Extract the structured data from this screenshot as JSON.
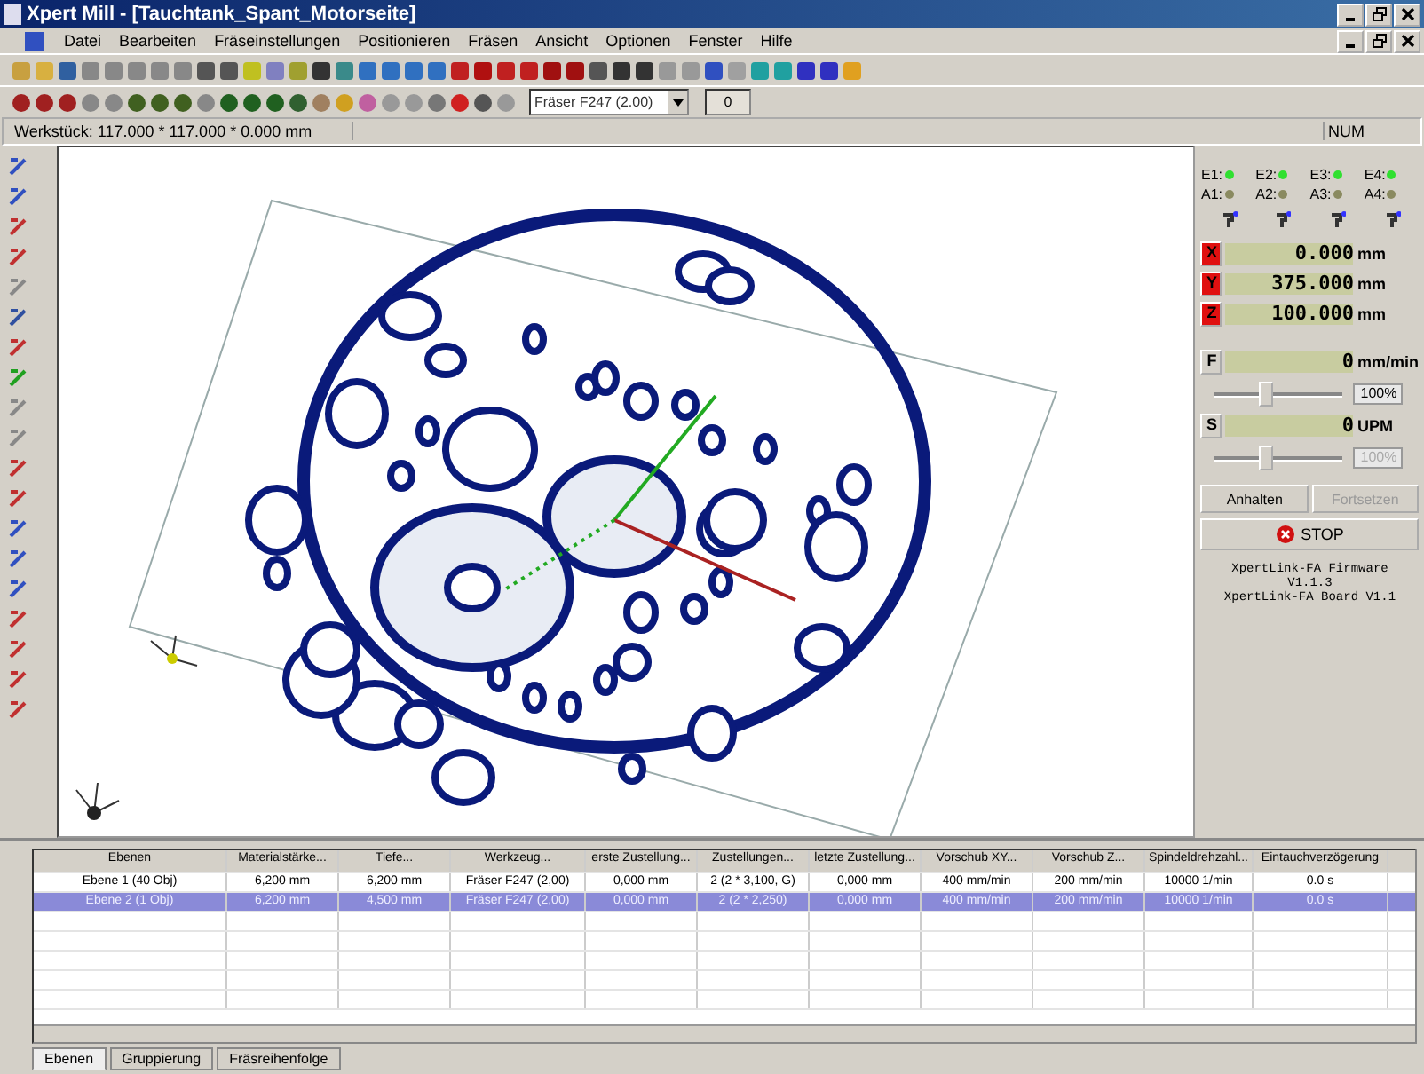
{
  "window": {
    "title": "Xpert Mill - [Tauchtank_Spant_Motorseite]"
  },
  "menu": [
    "Datei",
    "Bearbeiten",
    "Fräseinstellungen",
    "Positionieren",
    "Fräsen",
    "Ansicht",
    "Optionen",
    "Fenster",
    "Hilfe"
  ],
  "toolbar": {
    "tool_select": "Fräser F247 (2.00)",
    "spin_value": "0"
  },
  "info_bar": {
    "workpiece": "Werkstück: 117.000 * 117.000 * 0.000 mm",
    "indicator": "NUM"
  },
  "control_panel": {
    "leds": [
      {
        "label": "E1:",
        "on": true
      },
      {
        "label": "E2:",
        "on": true
      },
      {
        "label": "E3:",
        "on": true
      },
      {
        "label": "E4:",
        "on": true
      },
      {
        "label": "A1:",
        "on": false
      },
      {
        "label": "A2:",
        "on": false
      },
      {
        "label": "A3:",
        "on": false
      },
      {
        "label": "A4:",
        "on": false
      }
    ],
    "axes": [
      {
        "label": "X",
        "value": "0.000",
        "unit": "mm"
      },
      {
        "label": "Y",
        "value": "375.000",
        "unit": "mm"
      },
      {
        "label": "Z",
        "value": "100.000",
        "unit": "mm"
      }
    ],
    "feed": {
      "label": "F",
      "value": "0",
      "unit": "mm/min",
      "level": 0.38,
      "override": "100%",
      "disabled": false
    },
    "spindle": {
      "label": "S",
      "value": "0",
      "unit": "UPM",
      "level": 0.38,
      "override": "100%",
      "disabled": true
    },
    "buttons": [
      {
        "label": "Anhalten",
        "disabled": false
      },
      {
        "label": "Fortsetzen",
        "disabled": true
      }
    ],
    "stop": "STOP",
    "firmware": [
      "XpertLink-FA Firmware",
      "V1.1.3",
      "XpertLink-FA Board V1.1"
    ]
  },
  "table": {
    "columns": [
      "Ebenen",
      "Materialstärke...",
      "Tiefe...",
      "Werkzeug...",
      "erste Zustellung...",
      "Zustellungen...",
      "letzte Zustellung...",
      "Vorschub XY...",
      "Vorschub Z...",
      "Spindeldrehzahl...",
      "Eintauchverzögerung"
    ],
    "rows": [
      {
        "selected": false,
        "cells": [
          "Ebene 1 (40 Obj)",
          "6,200 mm",
          "6,200 mm",
          "Fräser F247 (2,00)",
          "0,000 mm",
          "2 (2 * 3,100, G)",
          "0,000 mm",
          "400 mm/min",
          "200 mm/min",
          "10000 1/min",
          "0.0 s"
        ]
      },
      {
        "selected": true,
        "cells": [
          "Ebene 2 (1 Obj)",
          "6,200 mm",
          "4,500 mm",
          "Fräser F247 (2,00)",
          "0,000 mm",
          "2 (2 * 2,250)",
          "0,000 mm",
          "400 mm/min",
          "200 mm/min",
          "10000 1/min",
          "0.0 s"
        ]
      }
    ]
  },
  "tabs": [
    {
      "label": "Ebenen",
      "selected": true
    },
    {
      "label": "Gruppierung",
      "selected": false
    },
    {
      "label": "Fräsreihenfolge",
      "selected": false
    }
  ]
}
